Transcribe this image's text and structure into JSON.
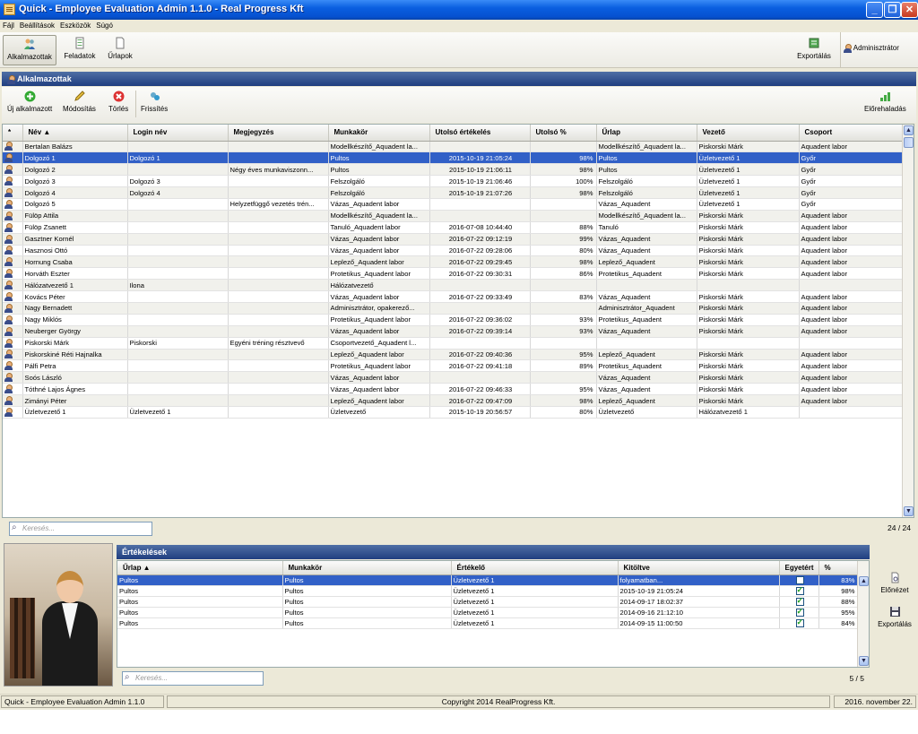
{
  "window": {
    "title": "Quick - Employee Evaluation Admin 1.1.0 - Real Progress Kft",
    "minimize": "_",
    "maximize": "❐",
    "close": "✕"
  },
  "menu": [
    "Fájl",
    "Beállítások",
    "Eszközök",
    "Súgó"
  ],
  "toolbar": {
    "employees": "Alkalmazottak",
    "tasks": "Feladatok",
    "forms": "Űrlapok",
    "export": "Exportálás",
    "admin": "Adminisztrátor"
  },
  "employees_panel": {
    "title": "Alkalmazottak",
    "new": "Új alkalmazott",
    "edit": "Módosítás",
    "delete": "Törlés",
    "refresh": "Frissítés",
    "progress": "Előrehaladás",
    "columns": [
      "*",
      "Név ▲",
      "Login név",
      "Megjegyzés",
      "Munkakör",
      "Utolsó értékelés",
      "Utolsó %",
      "Űrlap",
      "Vezető",
      "Csoport"
    ],
    "rows": [
      [
        "Bertalan Balázs",
        "",
        "",
        "Modellkészítő_Aquadent la...",
        "",
        "",
        "Modellkészítő_Aquadent la...",
        "Piskorski Márk",
        "Aquadent labor"
      ],
      [
        "Dolgozó 1",
        "Dolgozó 1",
        "",
        "Pultos",
        "2015-10-19 21:05:24",
        "98%",
        "Pultos",
        "Üzletvezető 1",
        "Győr"
      ],
      [
        "Dolgozó 2",
        "",
        "Négy éves munkaviszonn...",
        "Pultos",
        "2015-10-19 21:06:11",
        "98%",
        "Pultos",
        "Üzletvezető 1",
        "Győr"
      ],
      [
        "Dolgozó 3",
        "Dolgozó 3",
        "",
        "Felszolgáló",
        "2015-10-19 21:06:46",
        "100%",
        "Felszolgáló",
        "Üzletvezető 1",
        "Győr"
      ],
      [
        "Dolgozó 4",
        "Dolgozó 4",
        "",
        "Felszolgáló",
        "2015-10-19 21:07:26",
        "98%",
        "Felszolgáló",
        "Üzletvezető 1",
        "Győr"
      ],
      [
        "Dolgozó 5",
        "",
        "Helyzetfüggő vezetés trén...",
        "Vázas_Aquadent labor",
        "",
        "",
        "Vázas_Aquadent",
        "Üzletvezető 1",
        "Győr"
      ],
      [
        "Fülöp Attila",
        "",
        "",
        "Modellkészítő_Aquadent la...",
        "",
        "",
        "Modellkészítő_Aquadent la...",
        "Piskorski Márk",
        "Aquadent labor"
      ],
      [
        "Fülöp Zsanett",
        "",
        "",
        "Tanuló_Aquadent labor",
        "2016-07-08 10:44:40",
        "88%",
        "Tanuló",
        "Piskorski Márk",
        "Aquadent labor"
      ],
      [
        "Gasztner Kornél",
        "",
        "",
        "Vázas_Aquadent labor",
        "2016-07-22 09:12:19",
        "99%",
        "Vázas_Aquadent",
        "Piskorski Márk",
        "Aquadent labor"
      ],
      [
        "Hasznosi Ottó",
        "",
        "",
        "Vázas_Aquadent labor",
        "2016-07-22 09:28:06",
        "80%",
        "Vázas_Aquadent",
        "Piskorski Márk",
        "Aquadent labor"
      ],
      [
        "Hornung Csaba",
        "",
        "",
        "Leplező_Aquadent labor",
        "2016-07-22 09:29:45",
        "98%",
        "Leplező_Aquadent",
        "Piskorski Márk",
        "Aquadent labor"
      ],
      [
        "Horváth Eszter",
        "",
        "",
        "Protetikus_Aquadent labor",
        "2016-07-22 09:30:31",
        "86%",
        "Protetikus_Aquadent",
        "Piskorski Márk",
        "Aquadent labor"
      ],
      [
        "Hálózatvezető 1",
        "Ilona",
        "",
        "Hálózatvezető",
        "",
        "",
        "",
        "",
        ""
      ],
      [
        "Kovács Péter",
        "",
        "",
        "Vázas_Aquadent labor",
        "2016-07-22 09:33:49",
        "83%",
        "Vázas_Aquadent",
        "Piskorski Márk",
        "Aquadent labor"
      ],
      [
        "Nagy Bernadett",
        "",
        "",
        "Adminisztrátor, opakerező...",
        "",
        "",
        "Adminisztrátor_Aquadent",
        "Piskorski Márk",
        "Aquadent labor"
      ],
      [
        "Nagy Miklós",
        "",
        "",
        "Protetikus_Aquadent labor",
        "2016-07-22 09:36:02",
        "93%",
        "Protetikus_Aquadent",
        "Piskorski Márk",
        "Aquadent labor"
      ],
      [
        "Neuberger György",
        "",
        "",
        "Vázas_Aquadent labor",
        "2016-07-22 09:39:14",
        "93%",
        "Vázas_Aquadent",
        "Piskorski Márk",
        "Aquadent labor"
      ],
      [
        "Piskorski Márk",
        "Piskorski",
        "Egyéni tréning résztvevő",
        "Csoportvezető_Aquadent l...",
        "",
        "",
        "",
        "",
        ""
      ],
      [
        "Piskorskiné Réti Hajnalka",
        "",
        "",
        "Leplező_Aquadent labor",
        "2016-07-22 09:40:36",
        "95%",
        "Leplező_Aquadent",
        "Piskorski Márk",
        "Aquadent labor"
      ],
      [
        "Pálfi Petra",
        "",
        "",
        "Protetikus_Aquadent labor",
        "2016-07-22 09:41:18",
        "89%",
        "Protetikus_Aquadent",
        "Piskorski Márk",
        "Aquadent labor"
      ],
      [
        "Soós László",
        "",
        "",
        "Vázas_Aquadent labor",
        "",
        "",
        "Vázas_Aquadent",
        "Piskorski Márk",
        "Aquadent labor"
      ],
      [
        "Tóthné Lajos Ágnes",
        "",
        "",
        "Vázas_Aquadent labor",
        "2016-07-22 09:46:33",
        "95%",
        "Vázas_Aquadent",
        "Piskorski Márk",
        "Aquadent labor"
      ],
      [
        "Zimányi Péter",
        "",
        "",
        "Leplező_Aquadent labor",
        "2016-07-22 09:47:09",
        "98%",
        "Leplező_Aquadent",
        "Piskorski Márk",
        "Aquadent labor"
      ],
      [
        "Üzletvezető 1",
        "Üzletvezető 1",
        "",
        "Üzletvezető",
        "2015-10-19 20:56:57",
        "80%",
        "Üzletvezető",
        "Hálózatvezető 1",
        ""
      ]
    ],
    "selected_row": 1,
    "search_placeholder": "Keresés...",
    "count": "24 / 24"
  },
  "evaluations_panel": {
    "title": "Értékelések",
    "columns": [
      "Űrlap ▲",
      "Munkakör",
      "Értékelő",
      "Kitöltve",
      "Egyetért",
      "%"
    ],
    "rows": [
      [
        "Pultos",
        "Pultos",
        "Üzletvezető 1",
        "folyamatban...",
        false,
        "83%"
      ],
      [
        "Pultos",
        "Pultos",
        "Üzletvezető 1",
        "2015-10-19 21:05:24",
        true,
        "98%"
      ],
      [
        "Pultos",
        "Pultos",
        "Üzletvezető 1",
        "2014-09-17 18:02:37",
        true,
        "88%"
      ],
      [
        "Pultos",
        "Pultos",
        "Üzletvezető 1",
        "2014-09-16 21:12:10",
        true,
        "95%"
      ],
      [
        "Pultos",
        "Pultos",
        "Üzletvezető 1",
        "2014-09-15 11:00:50",
        true,
        "84%"
      ]
    ],
    "search_placeholder": "Keresés...",
    "count": "5 / 5",
    "preview": "Előnézet",
    "export": "Exportálás"
  },
  "status": {
    "app": "Quick - Employee Evaluation Admin 1.1.0",
    "copyright": "Copyright 2014 RealProgress Kft.",
    "date": "2016. november 22."
  }
}
